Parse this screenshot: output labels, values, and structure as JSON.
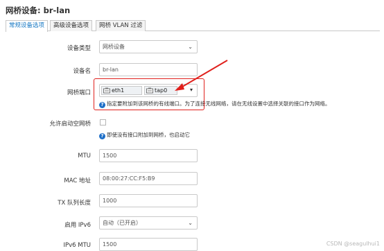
{
  "page": {
    "title": "网桥设备: br-lan"
  },
  "tabs": [
    {
      "label": "常规设备选项",
      "active": true
    },
    {
      "label": "高级设备选项",
      "active": false
    },
    {
      "label": "网桥 VLAN 过滤",
      "active": false
    }
  ],
  "fields": {
    "device_type": {
      "label": "设备类型",
      "value": "网桥设备"
    },
    "device_name": {
      "label": "设备名",
      "value": "br-lan"
    },
    "bridge_ports": {
      "label": "网桥端口",
      "ports": [
        "eth1",
        "tap0"
      ],
      "help": "指定要附加到该网桥的有线端口。为了连接无线网络，请在无线设置中选择关联的接口作为网络。"
    },
    "empty_bridge": {
      "label": "允许启动空网桥",
      "checked": false,
      "help": "即使没有接口附加到网桥，也启动它"
    },
    "mtu": {
      "label": "MTU",
      "value": "1500"
    },
    "mac": {
      "label": "MAC 地址",
      "value": "08:00:27:CC:F5:B9"
    },
    "txqueuelen": {
      "label": "TX 队列长度",
      "value": "1000"
    },
    "ipv6": {
      "label": "启用 IPv6",
      "value": "自动（已开启）"
    },
    "ipv6_mtu": {
      "label": "IPv6 MTU",
      "value": "1500"
    }
  },
  "watermark": "CSDN @seagulhui1",
  "colors": {
    "accent": "#1a7ac4",
    "highlight": "#e0201c",
    "help_icon": "#1e6fc8"
  }
}
